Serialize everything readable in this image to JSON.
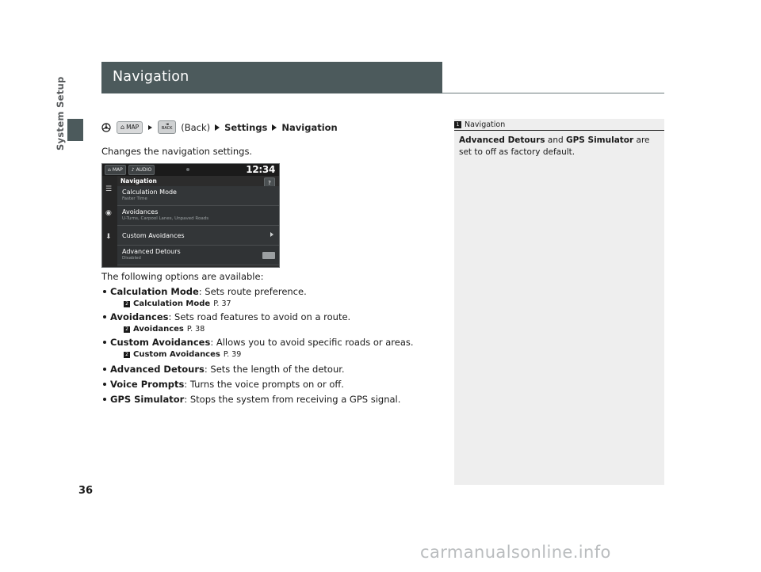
{
  "page": {
    "title": "Navigation",
    "side_tab_label": "System Setup",
    "page_number": "36",
    "watermark": "carmanualsonline.info"
  },
  "breadcrumb": {
    "steering_icon": "steering-wheel-icon",
    "map_button": "MAP",
    "back_button_line1": "BACK",
    "back_label": "(Back)",
    "settings": "Settings",
    "navigation": "Navigation"
  },
  "intro": "Changes the navigation settings.",
  "device": {
    "tab_map": "MAP",
    "tab_audio": "AUDIO",
    "clock": "12:34",
    "screen_title": "Navigation",
    "help_icon": "?",
    "rail_icons": [
      "menu-icon",
      "location-icon",
      "pin-icon"
    ],
    "items": [
      {
        "label": "Calculation Mode",
        "sub": "Faster Time",
        "control": "none"
      },
      {
        "label": "Avoidances",
        "sub": "U-Turns, Carpool Lanes, Unpaved Roads",
        "control": "none"
      },
      {
        "label": "Custom Avoidances",
        "sub": "",
        "control": "arrow"
      },
      {
        "label": "Advanced Detours",
        "sub": "Disabled",
        "control": "toggle"
      }
    ]
  },
  "after_text": "The following options are available:",
  "options": [
    {
      "name": "Calculation Mode",
      "desc": ": Sets route preference.",
      "ref_label": "Calculation Mode",
      "ref_page": "P. 37"
    },
    {
      "name": "Avoidances",
      "desc": ": Sets road features to avoid on a route.",
      "ref_label": "Avoidances",
      "ref_page": "P. 38"
    },
    {
      "name": "Custom Avoidances",
      "desc": ": Allows you to avoid specific roads or areas.",
      "ref_label": "Custom Avoidances",
      "ref_page": "P. 39"
    },
    {
      "name": "Advanced Detours",
      "desc": ": Sets the length of the detour.",
      "ref_label": "",
      "ref_page": ""
    },
    {
      "name": "Voice Prompts",
      "desc": ": Turns the voice prompts on or off.",
      "ref_label": "",
      "ref_page": ""
    },
    {
      "name": "GPS Simulator",
      "desc": ": Stops the system from receiving a GPS signal.",
      "ref_label": "",
      "ref_page": ""
    }
  ],
  "sidebar": {
    "heading": "Navigation",
    "note_b1": "Advanced Detours",
    "note_mid": " and ",
    "note_b2": "GPS Simulator",
    "note_end": " are set to off as factory default."
  },
  "colors": {
    "header_bar": "#4c5a5c",
    "sidebar_bg": "#eeeeee",
    "device_bg": "#2c2c2c"
  }
}
